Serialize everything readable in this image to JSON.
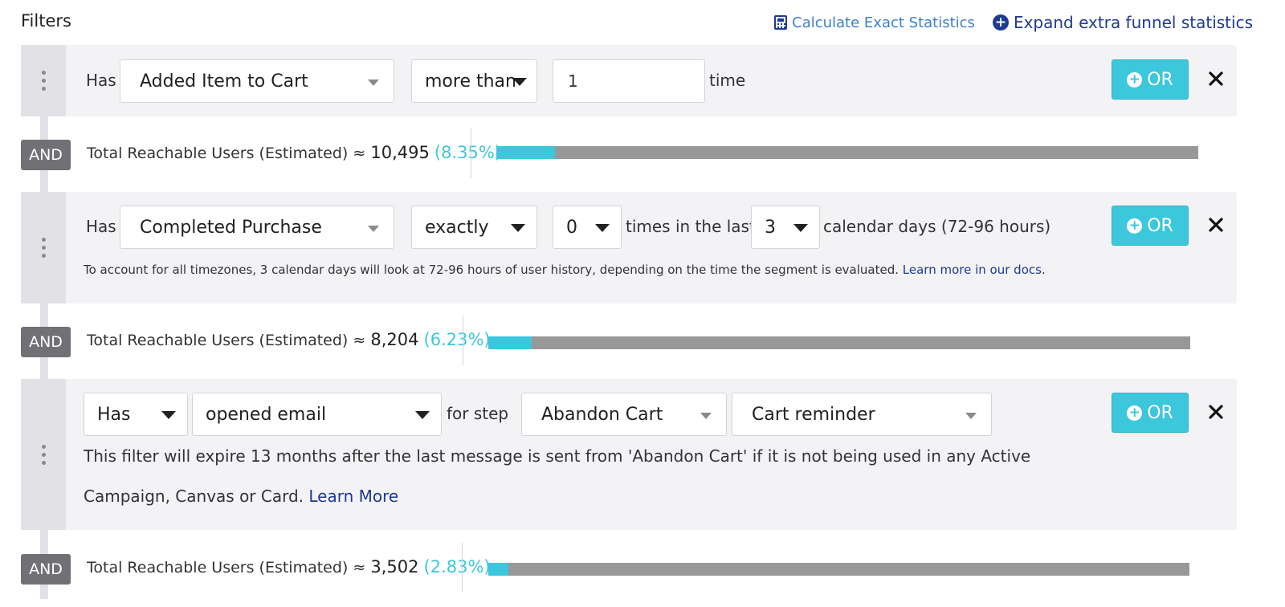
{
  "header": {
    "title": "Filters",
    "calc_label": "Calculate Exact Statistics",
    "expand_label": "Expand extra funnel statistics"
  },
  "filters": [
    {
      "prefix": "Has",
      "event": "Added Item to Cart",
      "comparison": "more than",
      "count": "1",
      "suffix": "time",
      "or_label": "OR"
    },
    {
      "prefix": "Has",
      "event": "Completed Purchase",
      "comparison": "exactly",
      "count": "0",
      "mid_label": "times in the last",
      "days": "3",
      "suffix": "calendar days (72-96 hours)",
      "note": "To account for all timezones, 3 calendar days will look at 72-96 hours of user history, depending on the time the segment is evaluated.",
      "note_link": "Learn more in our docs",
      "note_end": ".",
      "or_label": "OR"
    },
    {
      "prefix": "Has",
      "action": "opened email",
      "step_label": "for step",
      "campaign": "Abandon Cart",
      "variant": "Cart reminder",
      "note_line1": "This filter will expire 13 months after the last message is sent from 'Abandon Cart' if it is not being used in any Active",
      "note_line2": "Campaign, Canvas or Card.",
      "note_link": "Learn More",
      "or_label": "OR"
    }
  ],
  "reach": [
    {
      "and_label": "AND",
      "label": "Total Reachable Users (Estimated) ≈",
      "count": "10,495",
      "pct": "(8.35%)",
      "fraction": 0.0835
    },
    {
      "and_label": "AND",
      "label": "Total Reachable Users (Estimated) ≈",
      "count": "8,204",
      "pct": "(6.23%)",
      "fraction": 0.0623
    },
    {
      "and_label": "AND",
      "label": "Total Reachable Users (Estimated) ≈",
      "count": "3,502",
      "pct": "(2.83%)",
      "fraction": 0.0283
    }
  ],
  "colors": {
    "accent": "#3cc7dc",
    "link": "#1f3a93",
    "bar_track": "#989898",
    "and_badge": "#717175"
  }
}
